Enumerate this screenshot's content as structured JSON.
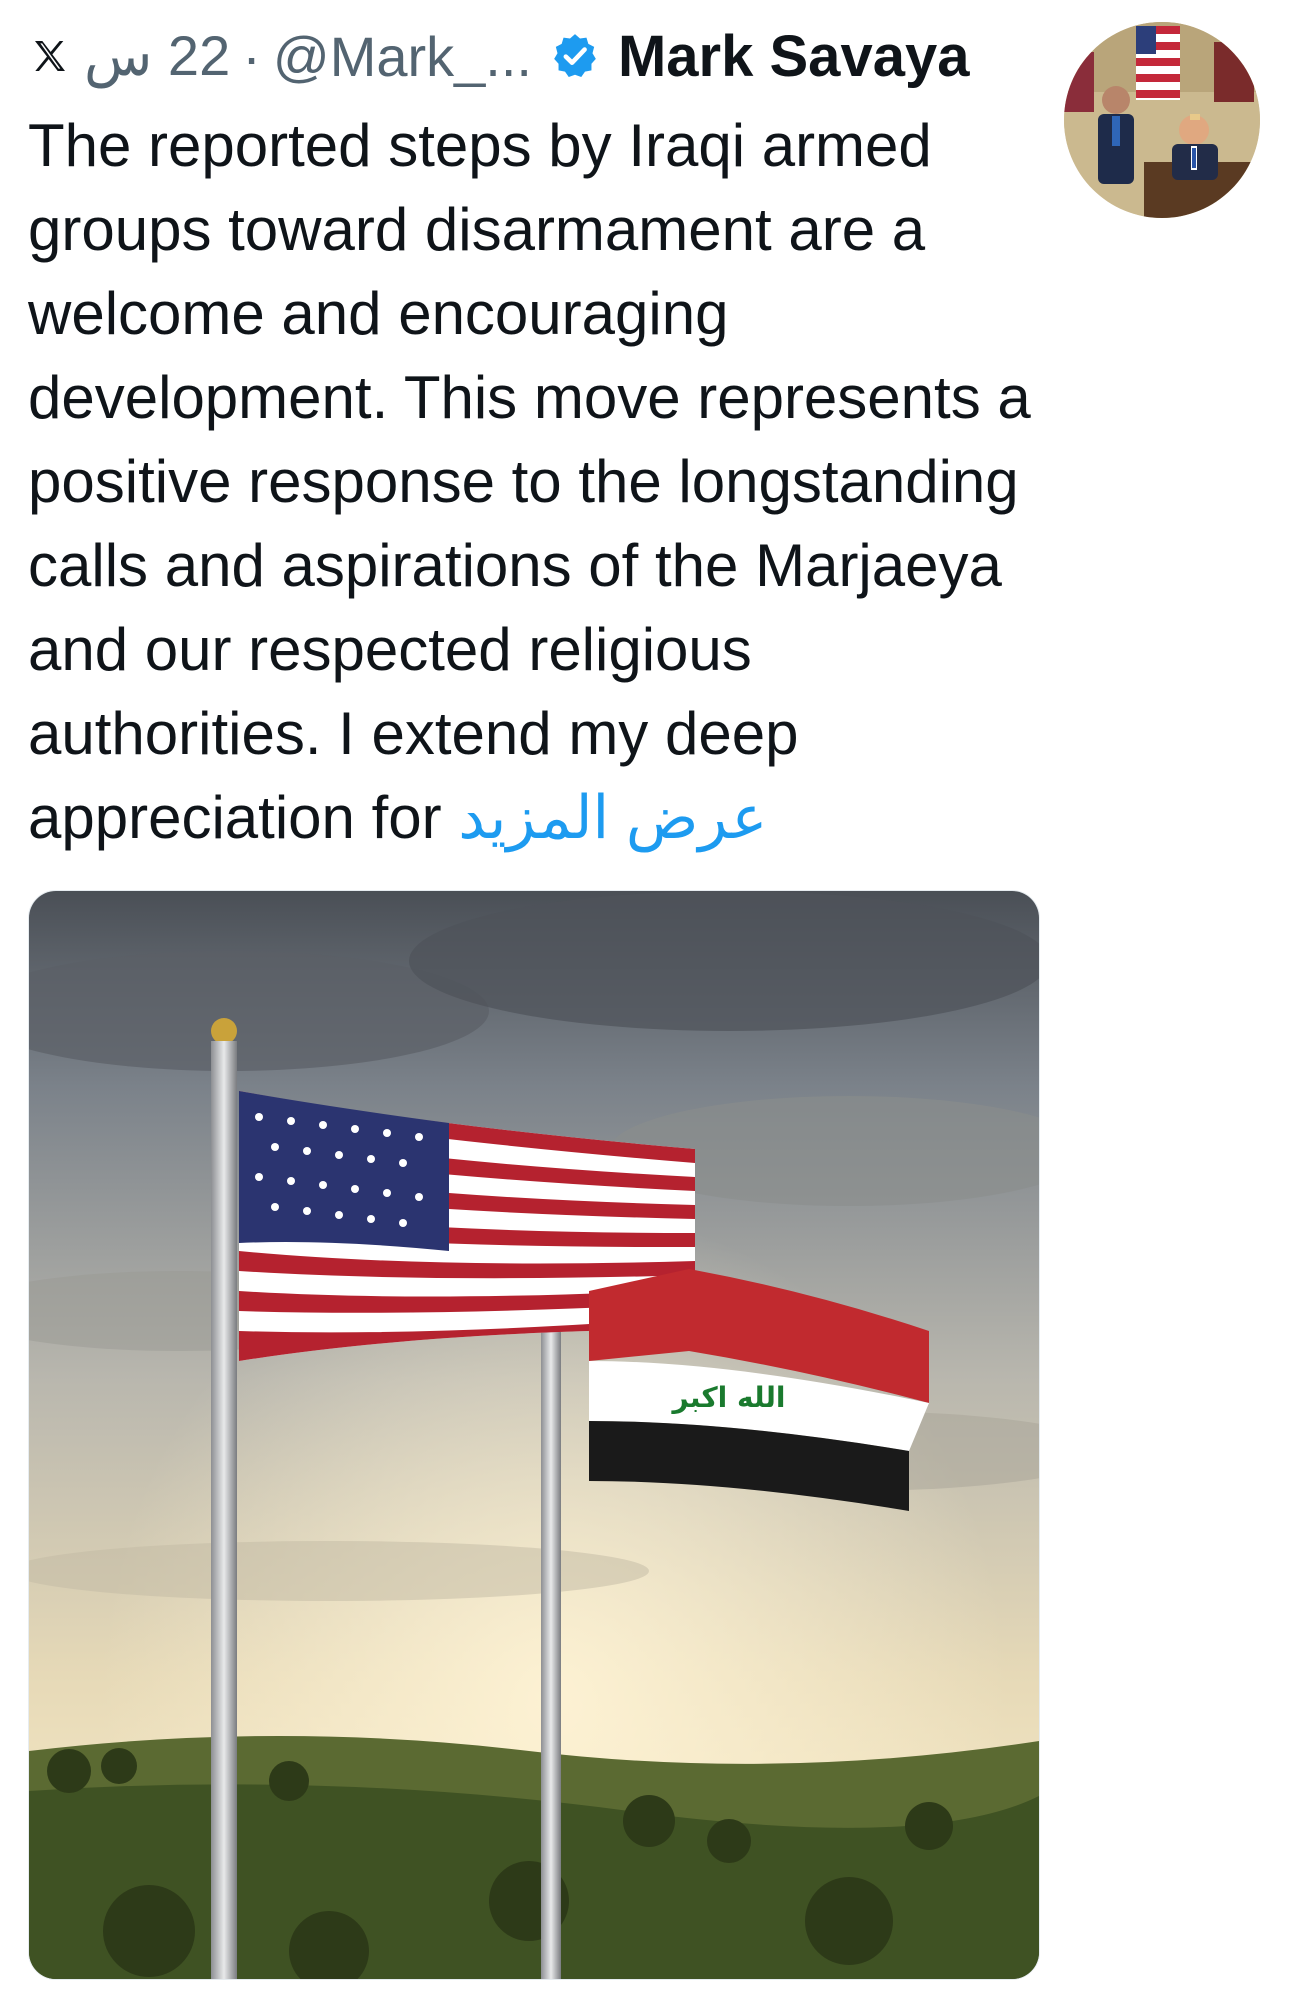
{
  "tweet": {
    "time": "22 س",
    "separator": "·",
    "handle": "@Mark_...",
    "display_name": "Mark Savaya",
    "body": "The reported steps by Iraqi armed groups toward disarmament are a welcome and encouraging development. This move represents a positive response to the longstanding calls and aspirations of the Marjaeya and our respected religious authorities. I extend my deep appreciation for ",
    "show_more": "عرض المزيد",
    "verified_icon": "verified-badge-icon",
    "platform_icon": "x-logo-icon",
    "media": {
      "flag_inscription": "الله اكبر"
    }
  },
  "colors": {
    "accent": "#1d9bf0",
    "text_primary": "#0f1419",
    "text_secondary": "#536471"
  }
}
